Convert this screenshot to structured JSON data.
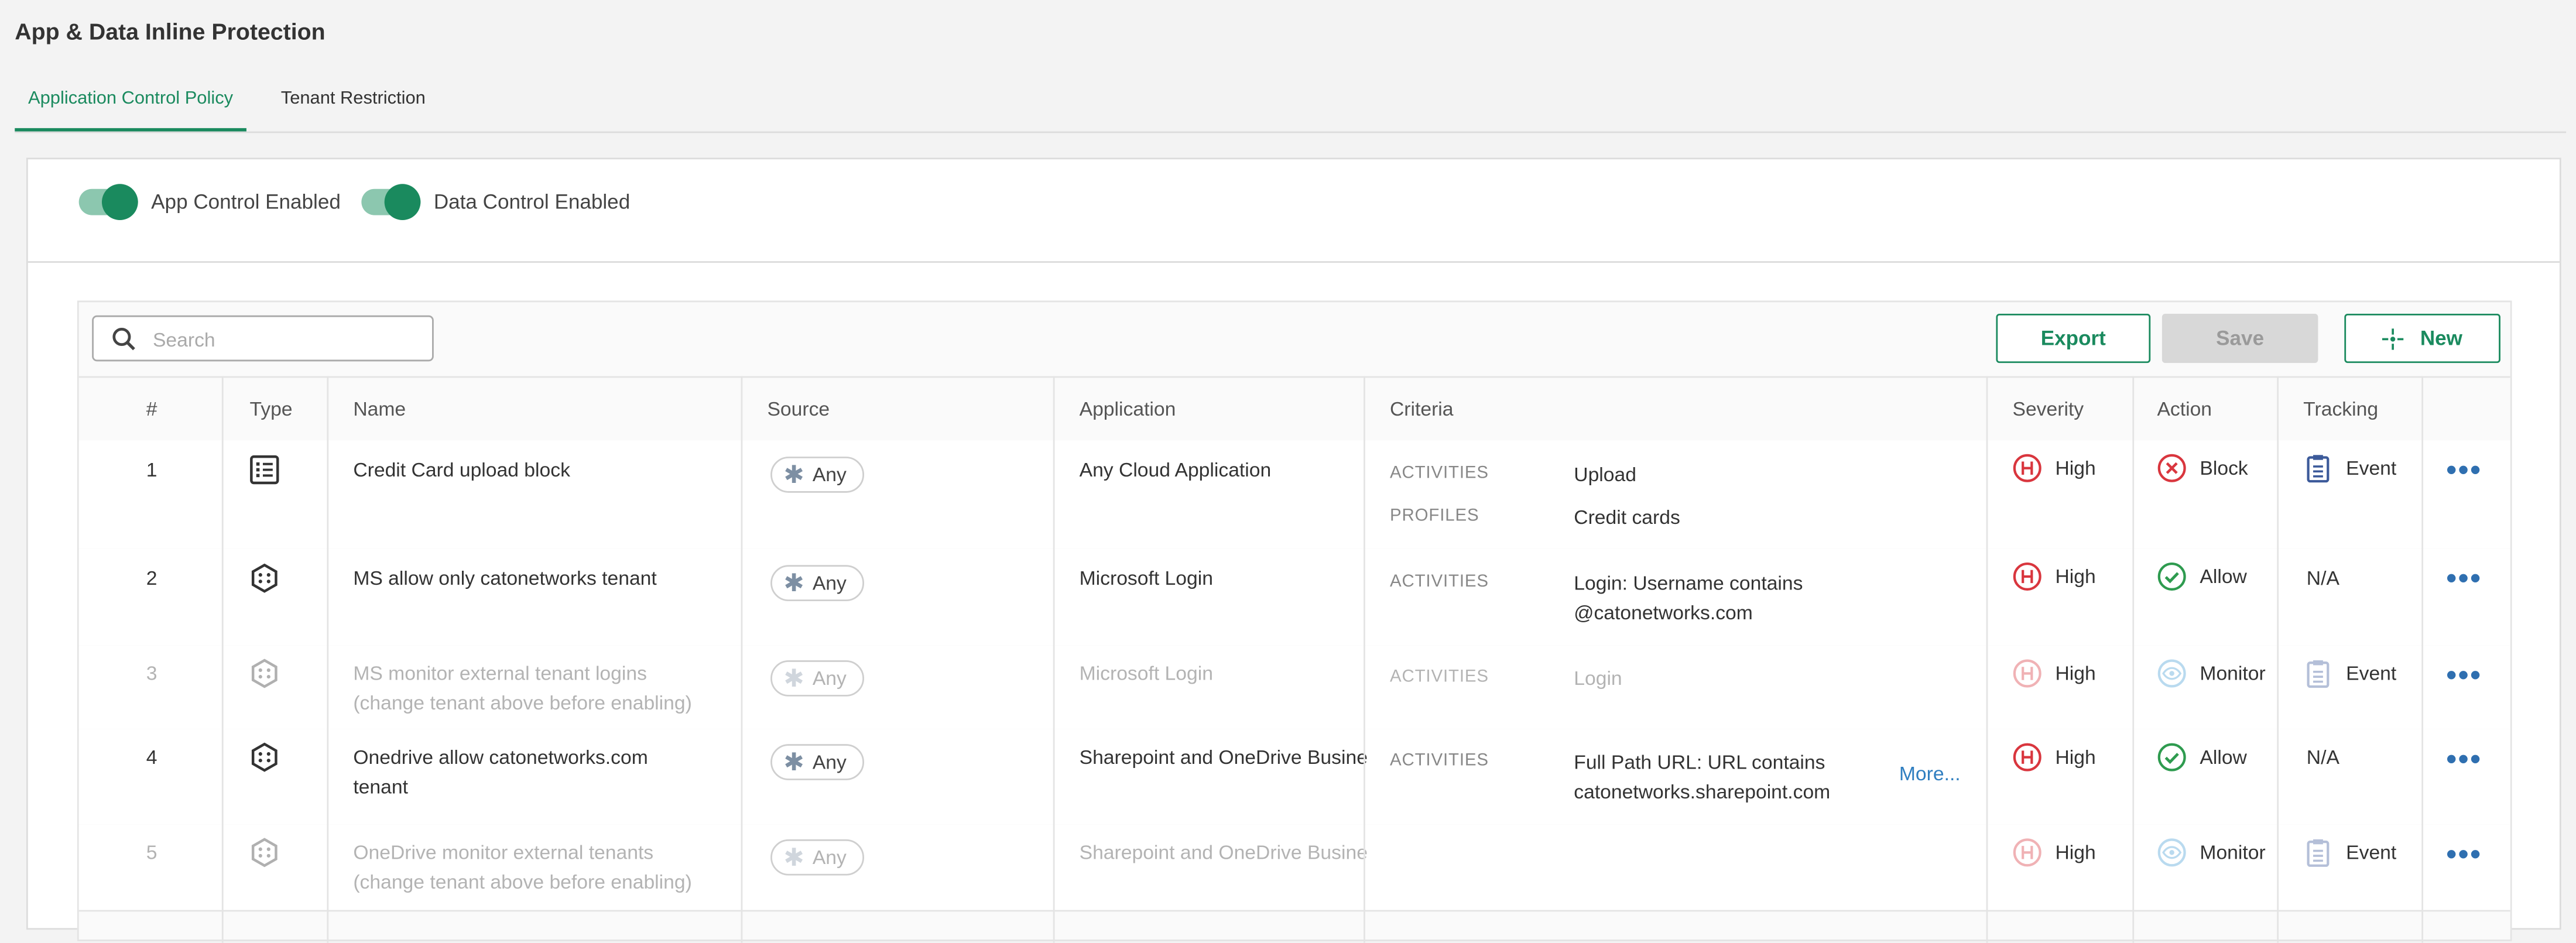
{
  "page": {
    "title": "App & Data Inline Protection"
  },
  "tabs": [
    {
      "label": "Application Control Policy",
      "active": true
    },
    {
      "label": "Tenant Restriction",
      "active": false
    }
  ],
  "toggles": {
    "app_control": {
      "label": "App Control Enabled",
      "on": true
    },
    "data_control": {
      "label": "Data Control Enabled",
      "on": true
    }
  },
  "toolbar": {
    "search_placeholder": "Search",
    "export_label": "Export",
    "save_label": "Save",
    "new_label": "New"
  },
  "table": {
    "headers": {
      "num": "#",
      "type": "Type",
      "name": "Name",
      "source": "Source",
      "application": "Application",
      "criteria": "Criteria",
      "severity": "Severity",
      "action": "Action",
      "tracking": "Tracking"
    },
    "rows": [
      {
        "num": "1",
        "type": "list-icon",
        "enabled": true,
        "name": [
          "Credit Card upload block"
        ],
        "source": "Any",
        "application": "Any Cloud Application",
        "criteria": [
          {
            "label": "ACTIVITIES",
            "value": [
              "Upload"
            ]
          },
          {
            "label": "PROFILES",
            "value": [
              "Credit cards"
            ]
          }
        ],
        "severity": "High",
        "action": "Block",
        "tracking": "Event"
      },
      {
        "num": "2",
        "type": "hexagon-icon",
        "enabled": true,
        "name": [
          "MS allow only catonetworks tenant"
        ],
        "source": "Any",
        "application": "Microsoft Login",
        "criteria": [
          {
            "label": "ACTIVITIES",
            "value": [
              "Login: Username contains",
              "@catonetworks.com"
            ]
          }
        ],
        "severity": "High",
        "action": "Allow",
        "tracking": "N/A"
      },
      {
        "num": "3",
        "type": "hexagon-icon",
        "enabled": false,
        "name": [
          "MS monitor external tenant logins",
          "(change tenant above before enabling)"
        ],
        "source": "Any",
        "application": "Microsoft Login",
        "criteria": [
          {
            "label": "ACTIVITIES",
            "value": [
              "Login"
            ]
          }
        ],
        "severity": "High",
        "action": "Monitor",
        "tracking": "Event"
      },
      {
        "num": "4",
        "type": "hexagon-icon",
        "enabled": true,
        "name": [
          "Onedrive allow catonetworks.com",
          "tenant"
        ],
        "source": "Any",
        "application": "Sharepoint and OneDrive Busine",
        "criteria": [
          {
            "label": "ACTIVITIES",
            "value": [
              "Full Path URL: URL contains",
              "catonetworks.sharepoint.com"
            ]
          }
        ],
        "more": "More...",
        "severity": "High",
        "action": "Allow",
        "tracking": "N/A"
      },
      {
        "num": "5",
        "type": "hexagon-icon",
        "enabled": false,
        "name": [
          "OneDrive monitor external tenants",
          "(change tenant above before enabling)"
        ],
        "source": "Any",
        "application": "Sharepoint and OneDrive Busine",
        "criteria": [],
        "severity": "High",
        "action": "Monitor",
        "tracking": "Event"
      }
    ]
  },
  "colors": {
    "accent": "#1a8a5e",
    "severity_high": "#d9363e",
    "block": "#d9363e",
    "allow": "#2e9b4f",
    "monitor": "#4a9fd6",
    "event": "#3c5a9a",
    "link": "#2f7ec0"
  }
}
